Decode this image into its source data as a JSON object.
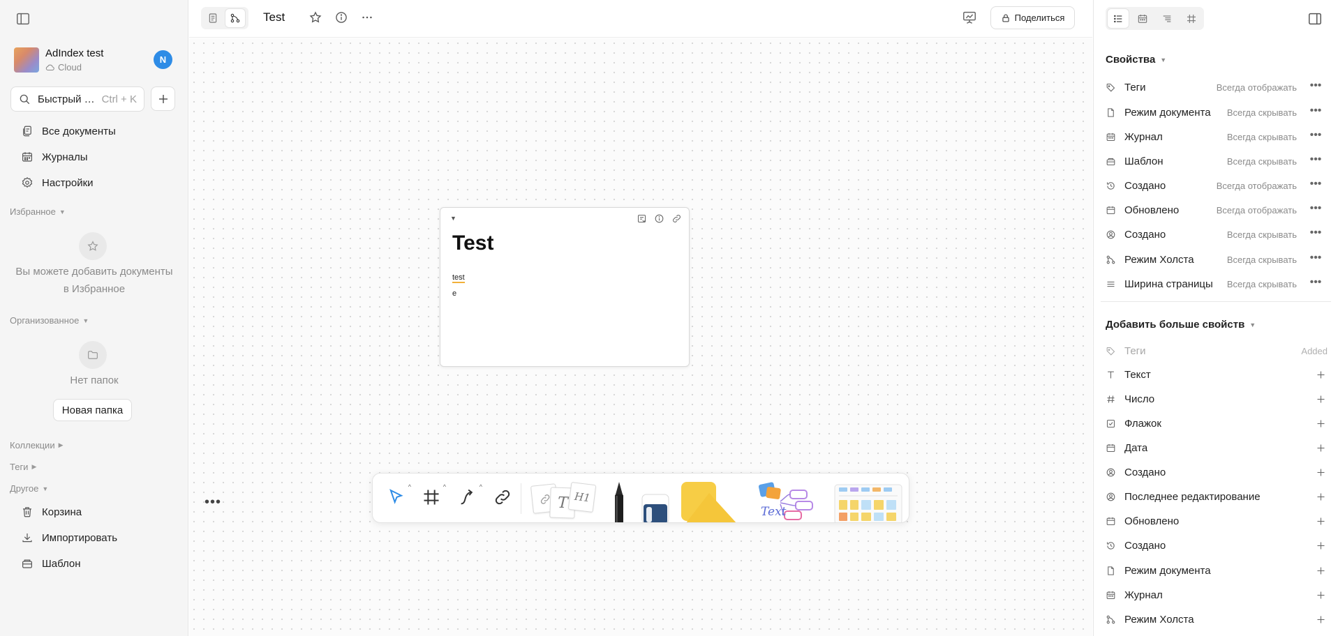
{
  "sidebar": {
    "workspace": {
      "name": "AdIndex test",
      "storage": "Cloud"
    },
    "user_initial": "N",
    "search": {
      "label": "Быстрый поиск",
      "shortcut": "Ctrl + K"
    },
    "nav": [
      "Все документы",
      "Журналы",
      "Настройки"
    ],
    "favorites": {
      "title": "Избранное",
      "empty_line1": "Вы можете добавить документы",
      "empty_line2": "в Избранное"
    },
    "organized": {
      "title": "Организованное",
      "empty": "Нет папок",
      "new_folder": "Новая папка"
    },
    "collections": "Коллекции",
    "tags": "Теги",
    "other": "Другое",
    "other_items": [
      "Корзина",
      "Импортировать",
      "Шаблон"
    ]
  },
  "topbar": {
    "title": "Test",
    "share": "Поделиться"
  },
  "canvas": {
    "note": {
      "title": "Test",
      "line1": "test",
      "line2": "e"
    },
    "toolbar": {
      "text_tool": "Text"
    }
  },
  "panel": {
    "properties_title": "Свойства",
    "properties": [
      {
        "name": "Теги",
        "visibility": "Всегда отображать",
        "icon": "tag-icon"
      },
      {
        "name": "Режим документа",
        "visibility": "Всегда скрывать",
        "icon": "document-icon"
      },
      {
        "name": "Журнал",
        "visibility": "Всегда скрывать",
        "icon": "calendar-icon"
      },
      {
        "name": "Шаблон",
        "visibility": "Всегда скрывать",
        "icon": "template-icon"
      },
      {
        "name": "Создано",
        "visibility": "Всегда отображать",
        "icon": "history-icon"
      },
      {
        "name": "Обновлено",
        "visibility": "Всегда отображать",
        "icon": "calendar-icon"
      },
      {
        "name": "Создано",
        "visibility": "Всегда скрывать",
        "icon": "user-icon"
      },
      {
        "name": "Режим Холста",
        "visibility": "Всегда скрывать",
        "icon": "edgeless-icon"
      },
      {
        "name": "Ширина страницы",
        "visibility": "Всегда скрывать",
        "icon": "lines-icon"
      }
    ],
    "add_title": "Добавить больше свойств",
    "add_items": [
      {
        "name": "Теги",
        "status": "Added",
        "icon": "tag-icon"
      },
      {
        "name": "Текст",
        "icon": "text-icon"
      },
      {
        "name": "Число",
        "icon": "hash-icon"
      },
      {
        "name": "Флажок",
        "icon": "checkbox-icon"
      },
      {
        "name": "Дата",
        "icon": "calendar-icon"
      },
      {
        "name": "Создано",
        "icon": "user-icon"
      },
      {
        "name": "Последнее редактирование",
        "icon": "user-icon"
      },
      {
        "name": "Обновлено",
        "icon": "calendar-icon"
      },
      {
        "name": "Создано",
        "icon": "history-icon"
      },
      {
        "name": "Режим документа",
        "icon": "document-icon"
      },
      {
        "name": "Журнал",
        "icon": "calendar-icon"
      },
      {
        "name": "Режим Холста",
        "icon": "edgeless-icon"
      }
    ]
  },
  "colors": {
    "accent": "#2e8ce6",
    "highlight": "#f2b13a",
    "shape_yellow": "#f7cd45"
  }
}
